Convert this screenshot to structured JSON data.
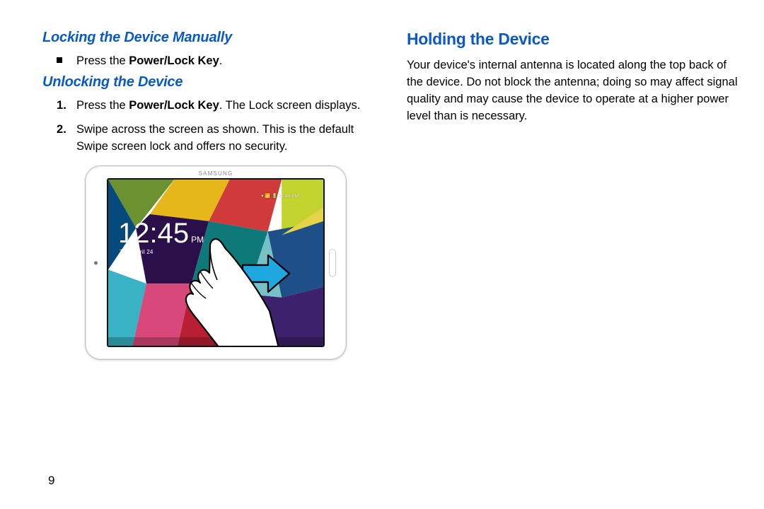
{
  "left": {
    "h1": "Locking the Device Manually",
    "bullet_prefix": "Press the ",
    "bullet_bold": "Power/Lock Key",
    "bullet_suffix": ".",
    "h2": "Unlocking the Device",
    "steps": [
      {
        "pre": "Press the ",
        "bold": "Power/Lock Key",
        "post": ". The Lock screen displays."
      },
      {
        "full": "Swipe across the screen as shown. This is the default Swipe screen lock and offers no security."
      }
    ]
  },
  "right": {
    "h1": "Holding the Device",
    "para": "Your device's internal antenna is located along the top back of the device. Do not block the antenna; doing so may affect signal quality and may cause the device to operate at a higher power level than is necessary."
  },
  "illustration": {
    "brand": "SAMSUNG",
    "status_text": "▾ 📶 🔋 12:45 PM",
    "clock_time": "12:45",
    "clock_ampm": "PM",
    "clock_date": "Thu, April 24"
  },
  "page_number": "9"
}
